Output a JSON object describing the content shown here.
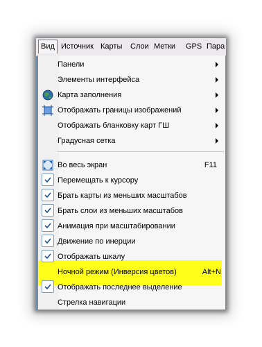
{
  "menubar": {
    "items": [
      "Вид",
      "Источник",
      "Карты",
      "Слои",
      "Метки",
      "GPS",
      "Пара"
    ]
  },
  "menu": {
    "panels": "Панели",
    "ui_elements": "Элементы интерфейса",
    "fill_map": "Карта заполнения",
    "image_bounds": "Отображать границы изображений",
    "gs_sheets": "Отображать бланковку карт ГШ",
    "degree_grid": "Градусная сетка",
    "fullscreen": "Во весь экран",
    "fullscreen_shortcut": "F11",
    "move_to_cursor": "Перемещать к курсору",
    "maps_from_smaller_scales": "Брать карты из меньших масштабов",
    "layers_from_smaller_scales": "Брать слои из меньших масштабов",
    "zoom_animation": "Анимация при масштабировании",
    "inertia_motion": "Движение по инерции",
    "show_scale": "Отображать шкалу",
    "night_mode": "Ночной режим (Инверсия цветов)",
    "night_mode_shortcut": "Alt+N",
    "show_last_selection": "Отображать последнее выделение",
    "nav_arrow": "Стрелка навигации"
  },
  "colors": {
    "highlight": "#ffff1a",
    "check_border": "#7f9db9",
    "menubar_bg": "#ebe9ed"
  }
}
